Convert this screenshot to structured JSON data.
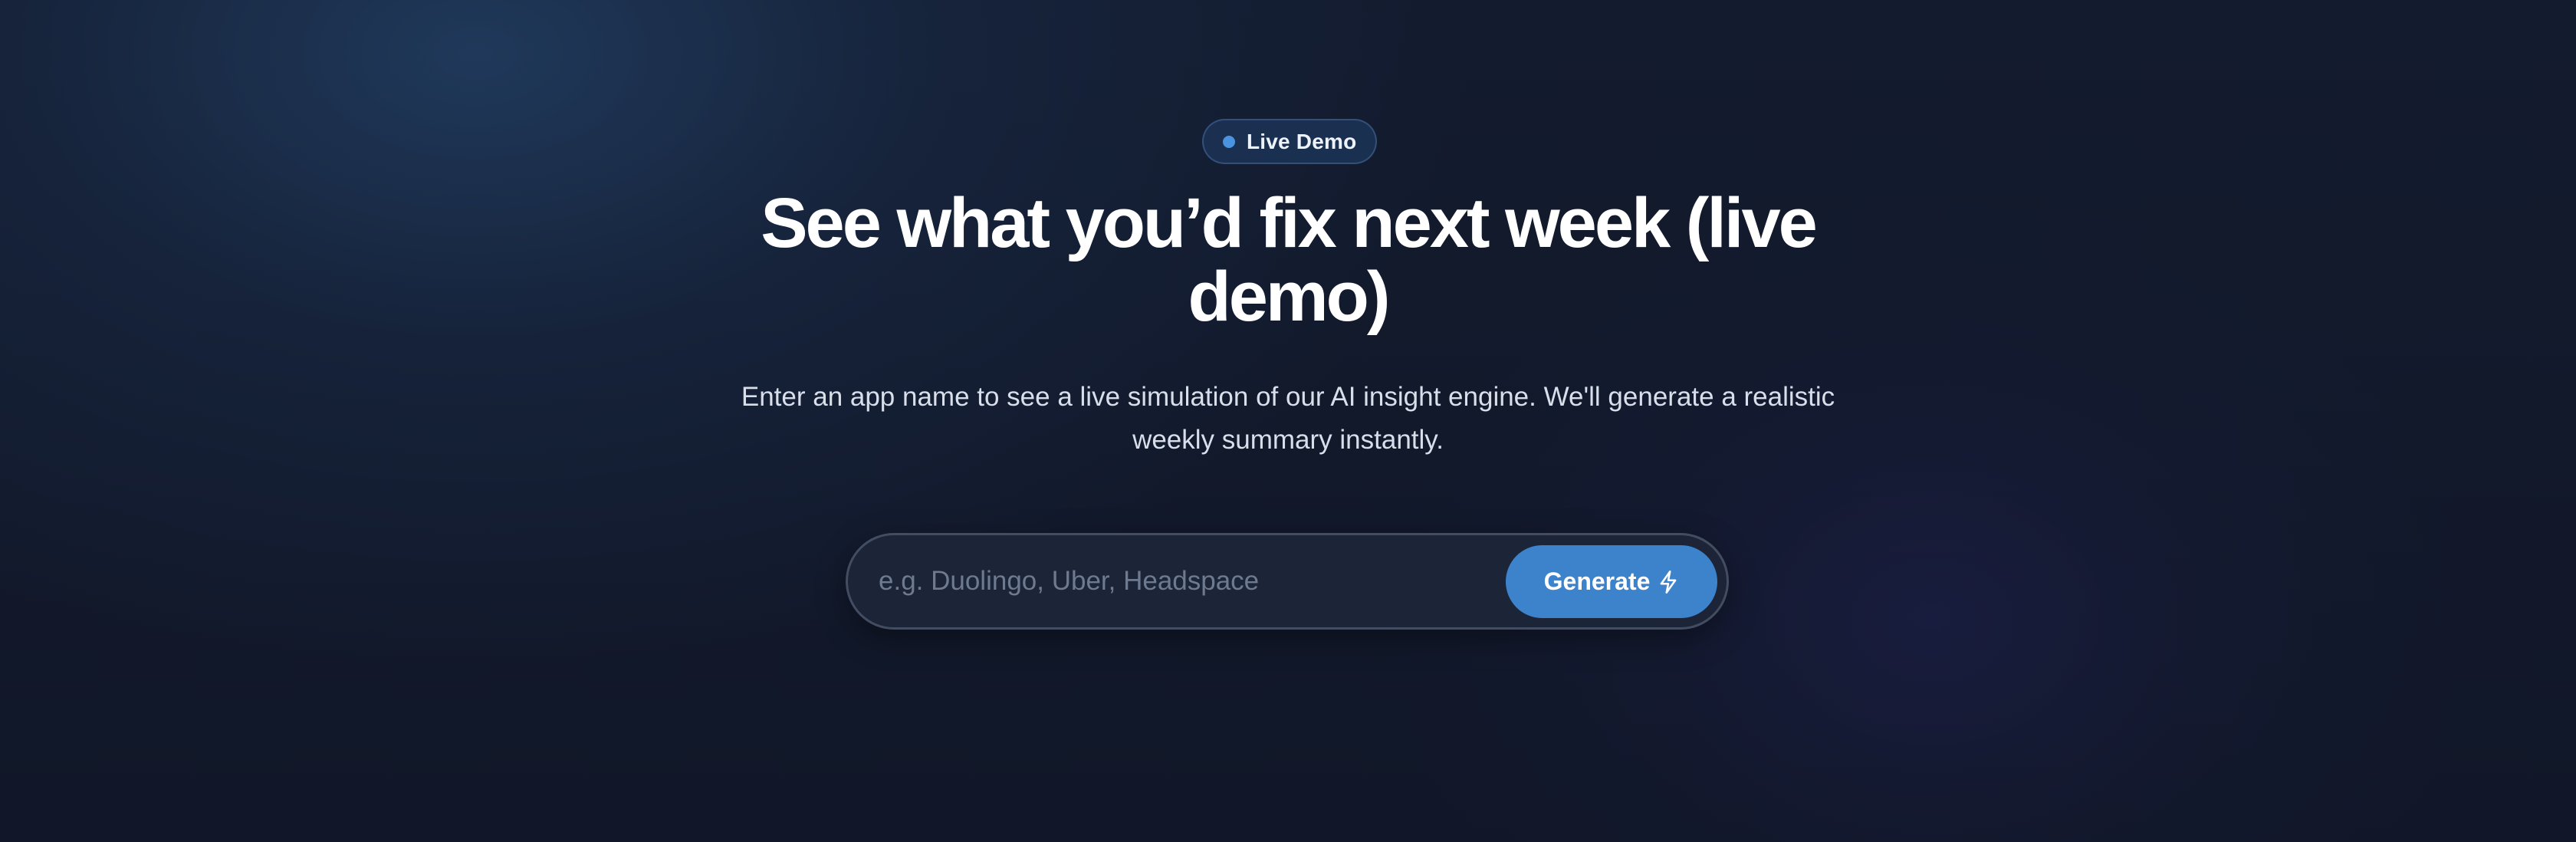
{
  "badge": {
    "label": "Live Demo",
    "dot_color": "#4a93e0"
  },
  "headline": "See what you’d fix next week (live demo)",
  "subtitle": "Enter an app name to see a live simulation of our AI insight engine. We'll generate a realistic weekly summary instantly.",
  "search": {
    "value": "",
    "placeholder": "e.g. Duolingo, Uber, Headspace"
  },
  "generate_button": {
    "label": "Generate",
    "icon": "lightning-bolt-icon",
    "color": "#3d83cc"
  },
  "colors": {
    "background": "#111728",
    "accent": "#3d83cc",
    "text": "#ffffff"
  }
}
